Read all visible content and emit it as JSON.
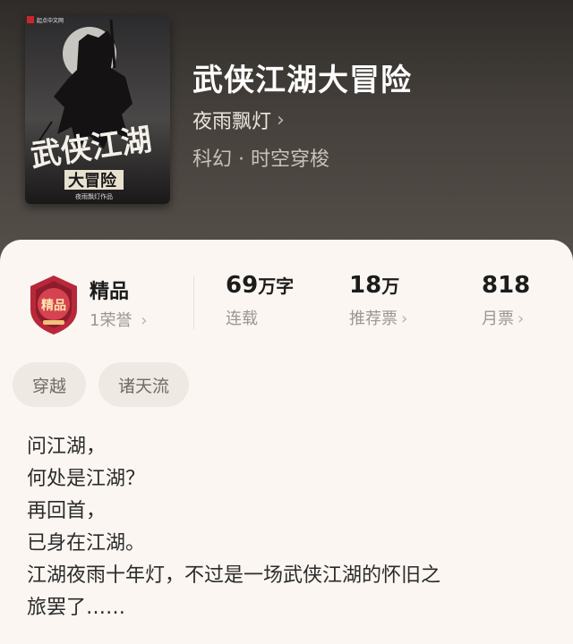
{
  "cover": {
    "publisher": "起点中文网",
    "title_art": "武侠江湖",
    "subtitle_art": "大冒险",
    "author_line": "夜雨飘灯作品"
  },
  "book": {
    "title": "武侠江湖大冒险",
    "author": "夜雨飘灯",
    "genre": "科幻 · 时空穿梭"
  },
  "badge": {
    "icon_text": "精品",
    "title": "精品",
    "honor": "1荣誉"
  },
  "stats": [
    {
      "value": "69",
      "unit": "万字",
      "label": "连载"
    },
    {
      "value": "18",
      "unit": "万",
      "label": "推荐票"
    },
    {
      "value": "818",
      "unit": "",
      "label": "月票"
    }
  ],
  "tags": [
    "穿越",
    "诸天流"
  ],
  "intro": [
    "问江湖，",
    "何处是江湖？",
    "再回首，",
    "已身在江湖。",
    "江湖夜雨十年灯，不过是一场武侠江湖的怀旧之",
    "旅罢了……"
  ],
  "colors": {
    "header_bg": "#46413c",
    "card_bg": "#fbf6f2",
    "badge_red": "#b8283a",
    "tag_bg": "#efe9e4"
  }
}
